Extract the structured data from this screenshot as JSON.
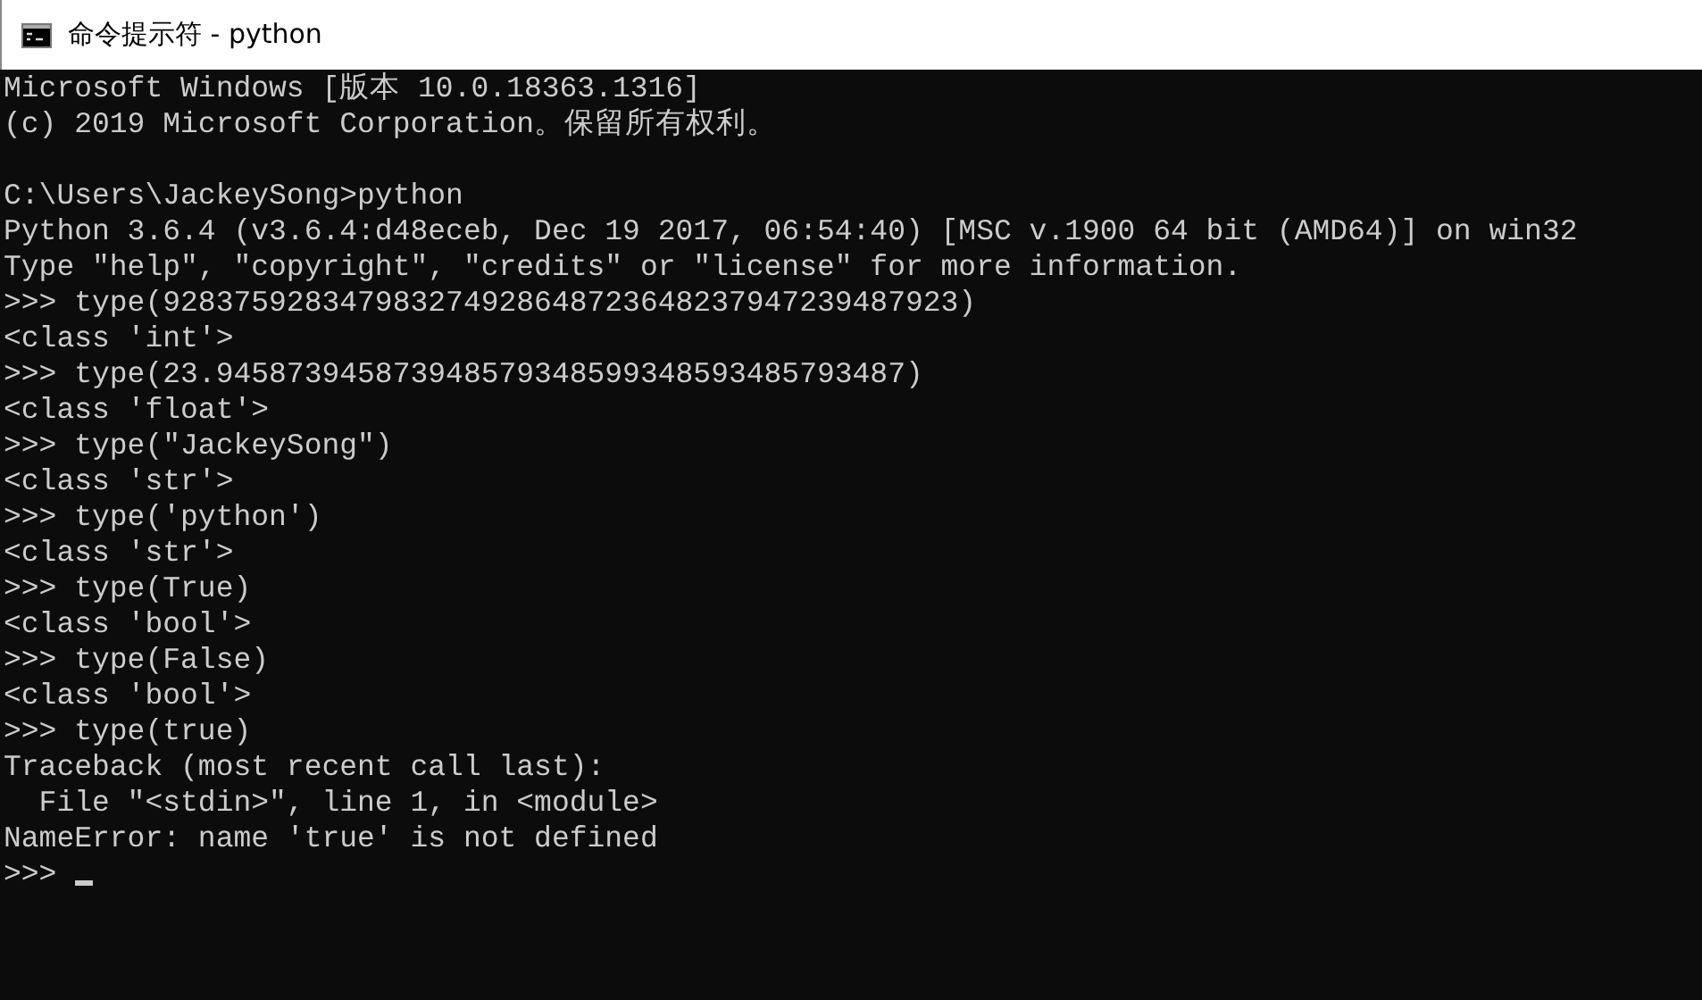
{
  "window": {
    "title": "命令提示符 - python"
  },
  "console": {
    "blocks": [
      [
        "Microsoft Windows [版本 10.0.18363.1316]",
        "(c) 2019 Microsoft Corporation。保留所有权利。"
      ],
      [
        "C:\\Users\\JackeySong>python",
        "Python 3.6.4 (v3.6.4:d48eceb, Dec 19 2017, 06:54:40) [MSC v.1900 64 bit (AMD64)] on win32",
        "Type \"help\", \"copyright\", \"credits\" or \"license\" for more information.",
        ">>> type(928375928347983274928648723648237947239487923)",
        "<class 'int'>",
        ">>> type(23.945873945873948579348599348593485793487)",
        "<class 'float'>",
        ">>> type(\"JackeySong\")",
        "<class 'str'>",
        ">>> type('python')",
        "<class 'str'>",
        ">>> type(True)",
        "<class 'bool'>",
        ">>> type(False)",
        "<class 'bool'>",
        ">>> type(true)",
        "Traceback (most recent call last):",
        "  File \"<stdin>\", line 1, in <module>",
        "NameError: name 'true' is not defined"
      ]
    ],
    "prompt": ">>>"
  }
}
